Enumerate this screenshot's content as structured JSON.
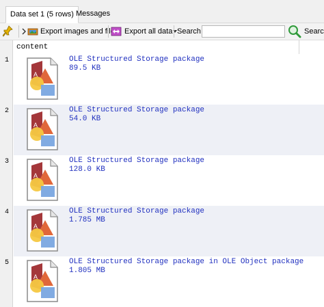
{
  "tabs": [
    {
      "label": "Data set 1 (5 rows)",
      "active": true
    },
    {
      "label": "Messages",
      "active": false
    }
  ],
  "toolbar": {
    "export_images_label": "Export images and files",
    "export_all_label": "Export all data",
    "search_label": "Search",
    "search_value": "",
    "search_button_label": "Search"
  },
  "grid": {
    "column_header": "content",
    "rows": [
      {
        "num": "1",
        "type": "OLE Structured Storage package",
        "size": "89.5 KB"
      },
      {
        "num": "2",
        "type": "OLE Structured Storage package",
        "size": "54.0 KB"
      },
      {
        "num": "3",
        "type": "OLE Structured Storage package",
        "size": "128.0 KB"
      },
      {
        "num": "4",
        "type": "OLE Structured Storage package",
        "size": "1.785 MB"
      },
      {
        "num": "5",
        "type": "OLE Structured Storage package in OLE Object package",
        "size": "1.805 MB"
      }
    ]
  },
  "icons": {
    "pin": "pin-icon",
    "export_images": "export-images-icon",
    "export_all": "export-all-icon",
    "search": "magnifier-icon",
    "file": "office-document-icon"
  },
  "colors": {
    "link_text": "#1f2fbf",
    "alt_row": "#eef0f6",
    "search_green": "#2f9a3a"
  }
}
